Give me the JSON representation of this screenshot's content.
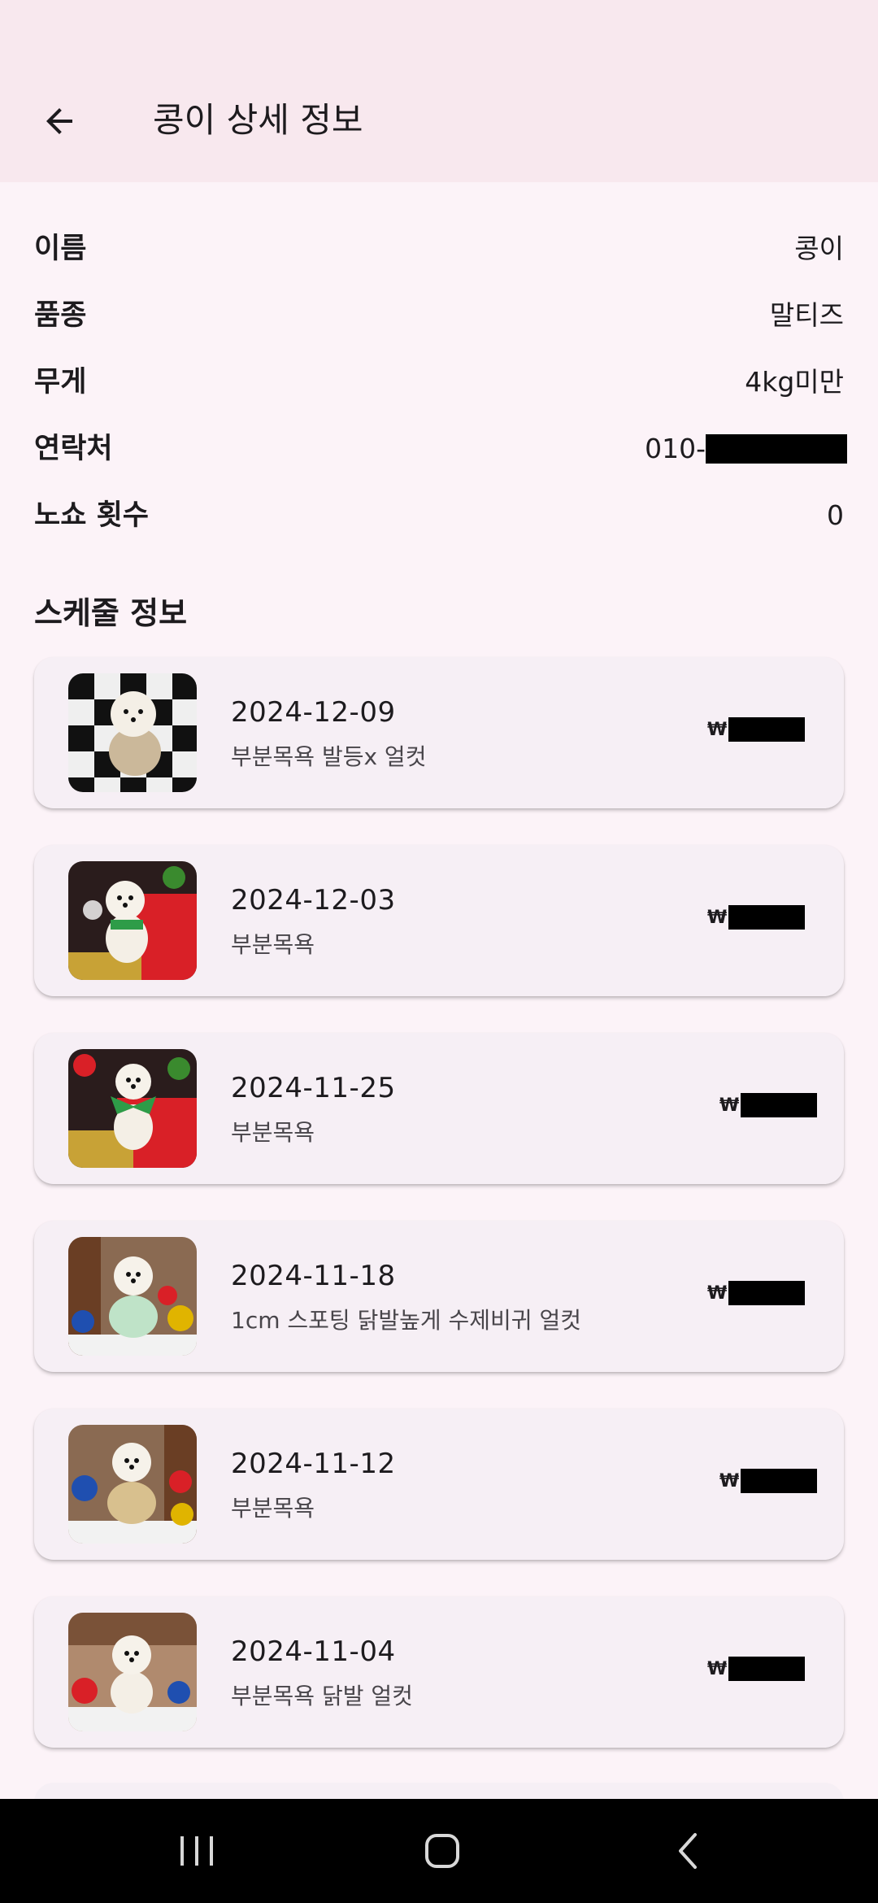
{
  "header": {
    "title": "콩이 상세 정보",
    "back_icon": "arrow-left-icon"
  },
  "info": {
    "rows": [
      {
        "label": "이름",
        "value": "콩이"
      },
      {
        "label": "품종",
        "value": "말티즈"
      },
      {
        "label": "무게",
        "value": "4kg미만"
      },
      {
        "label": "연락처",
        "value": "010-"
      },
      {
        "label": "노쇼 횟수",
        "value": "0"
      }
    ]
  },
  "schedule": {
    "title": "스케줄 정보",
    "currency_symbol": "₩",
    "items": [
      {
        "date": "2024-12-09",
        "description": "부분목욕 발등x 얼컷"
      },
      {
        "date": "2024-12-03",
        "description": "부분목욕"
      },
      {
        "date": "2024-11-25",
        "description": "부분목욕"
      },
      {
        "date": "2024-11-18",
        "description": "1cm 스포팅 닭발높게 수제비귀 얼컷"
      },
      {
        "date": "2024-11-12",
        "description": "부분목욕"
      },
      {
        "date": "2024-11-04",
        "description": "부분목욕 닭발 얼컷"
      }
    ]
  },
  "navbar": {
    "recent_icon": "recent-apps-icon",
    "home_icon": "home-icon",
    "back_icon": "back-chevron-icon"
  },
  "colors": {
    "appbar_bg": "#f8e8ee",
    "page_bg": "#fcf3f8",
    "card_bg": "#f6eff5"
  }
}
